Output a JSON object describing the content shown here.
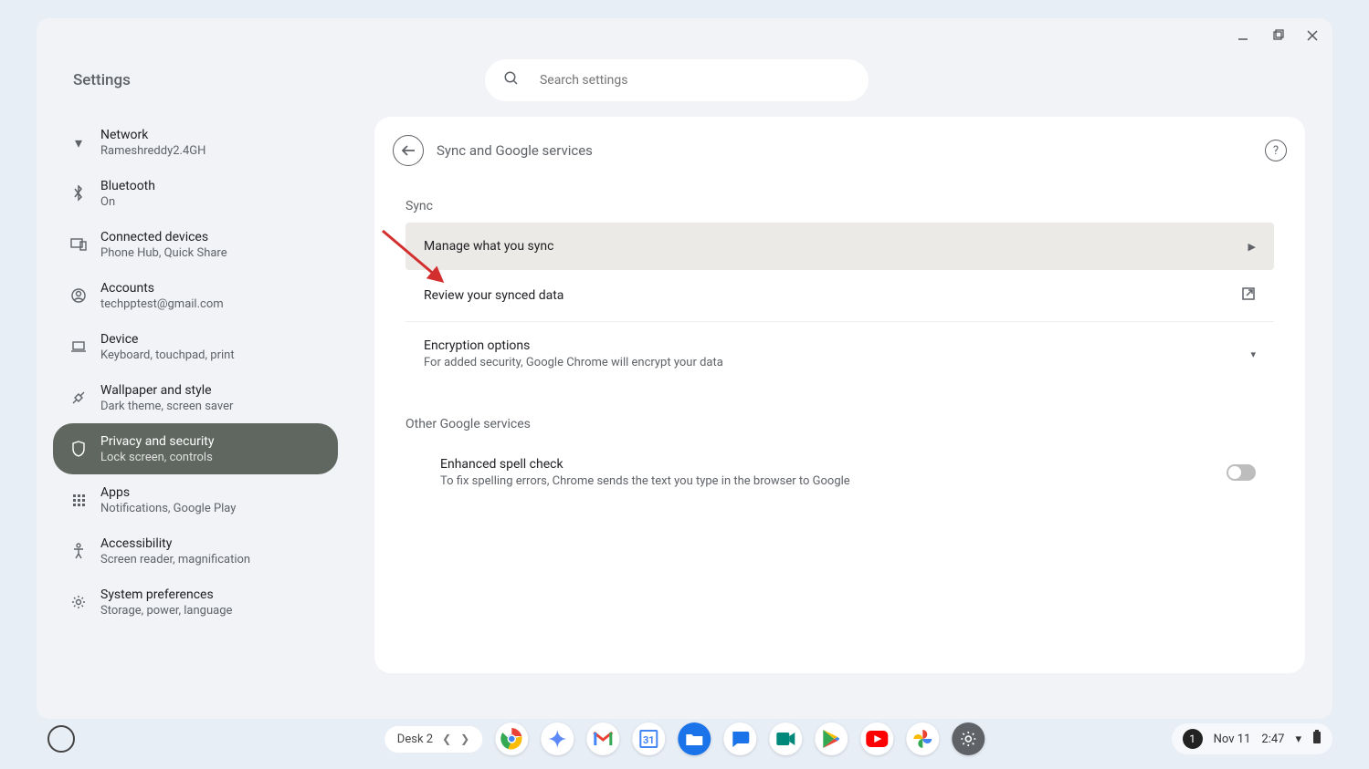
{
  "window": {
    "title": "Settings"
  },
  "search": {
    "placeholder": "Search settings"
  },
  "sidebar": {
    "items": [
      {
        "label": "Network",
        "sub": "Rameshreddy2.4GH"
      },
      {
        "label": "Bluetooth",
        "sub": "On"
      },
      {
        "label": "Connected devices",
        "sub": "Phone Hub, Quick Share"
      },
      {
        "label": "Accounts",
        "sub": "techpptest@gmail.com"
      },
      {
        "label": "Device",
        "sub": "Keyboard, touchpad, print"
      },
      {
        "label": "Wallpaper and style",
        "sub": "Dark theme, screen saver"
      },
      {
        "label": "Privacy and security",
        "sub": "Lock screen, controls"
      },
      {
        "label": "Apps",
        "sub": "Notifications, Google Play"
      },
      {
        "label": "Accessibility",
        "sub": "Screen reader, magnification"
      },
      {
        "label": "System preferences",
        "sub": "Storage, power, language"
      }
    ]
  },
  "panel": {
    "title": "Sync and Google services",
    "sync_section": "Sync",
    "manage_sync": "Manage what you sync",
    "review_synced": "Review your synced data",
    "encryption_label": "Encryption options",
    "encryption_sub": "For added security, Google Chrome will encrypt your data",
    "other_section": "Other Google services",
    "spellcheck_label": "Enhanced spell check",
    "spellcheck_sub": "To fix spelling errors, Chrome sends the text you type in the browser to Google"
  },
  "shelf": {
    "desk": "Desk 2",
    "notif_count": "1",
    "date": "Nov 11",
    "time": "2:47"
  }
}
